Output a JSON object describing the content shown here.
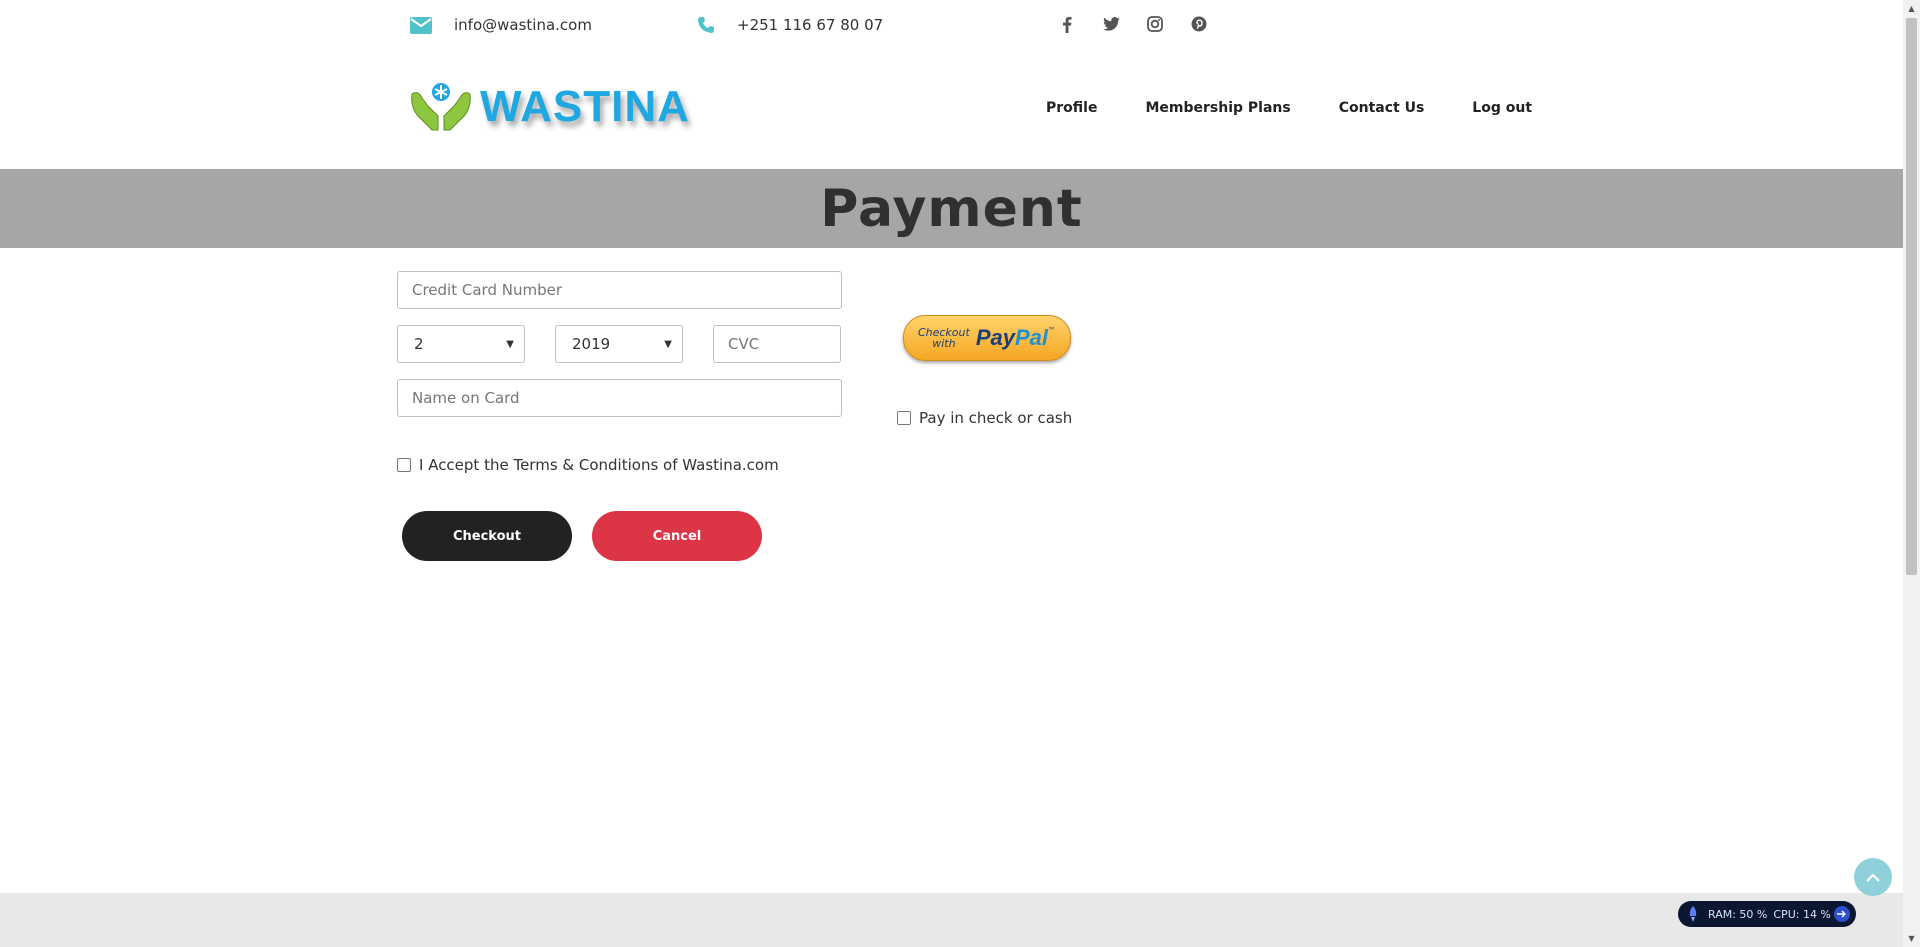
{
  "topbar": {
    "email": "info@wastina.com",
    "phone": "+251 116 67 80 07",
    "social_icons": [
      "facebook-icon",
      "twitter-icon",
      "instagram-icon",
      "pinterest-icon"
    ],
    "icon_color": "#4fc3c9"
  },
  "header": {
    "logo_text": "WASTINA",
    "nav": {
      "profile": "Profile",
      "membership": "Membership Plans",
      "contact": "Contact Us",
      "logout": "Log out"
    }
  },
  "banner": {
    "title": "Payment",
    "background": "#a6a6a6"
  },
  "form": {
    "card_number_placeholder": "Credit Card Number",
    "expiry_month": "2",
    "expiry_year": "2019",
    "cvc_placeholder": "CVC",
    "name_placeholder": "Name on Card",
    "terms_label": "I Accept the Terms & Conditions of Wastina.com",
    "pay_check_label": "Pay in check or cash",
    "checkout_label": "Checkout",
    "cancel_label": "Cancel"
  },
  "paypal": {
    "line1": "Checkout",
    "line2": "with",
    "brand_pay": "Pay",
    "brand_pal": "Pal",
    "tm": "™"
  },
  "system_monitor": {
    "ram": "RAM: 50 %",
    "cpu": "CPU: 14 %"
  },
  "colors": {
    "accent": "#4fc3c9",
    "danger": "#dc3545",
    "dark": "#222222"
  }
}
